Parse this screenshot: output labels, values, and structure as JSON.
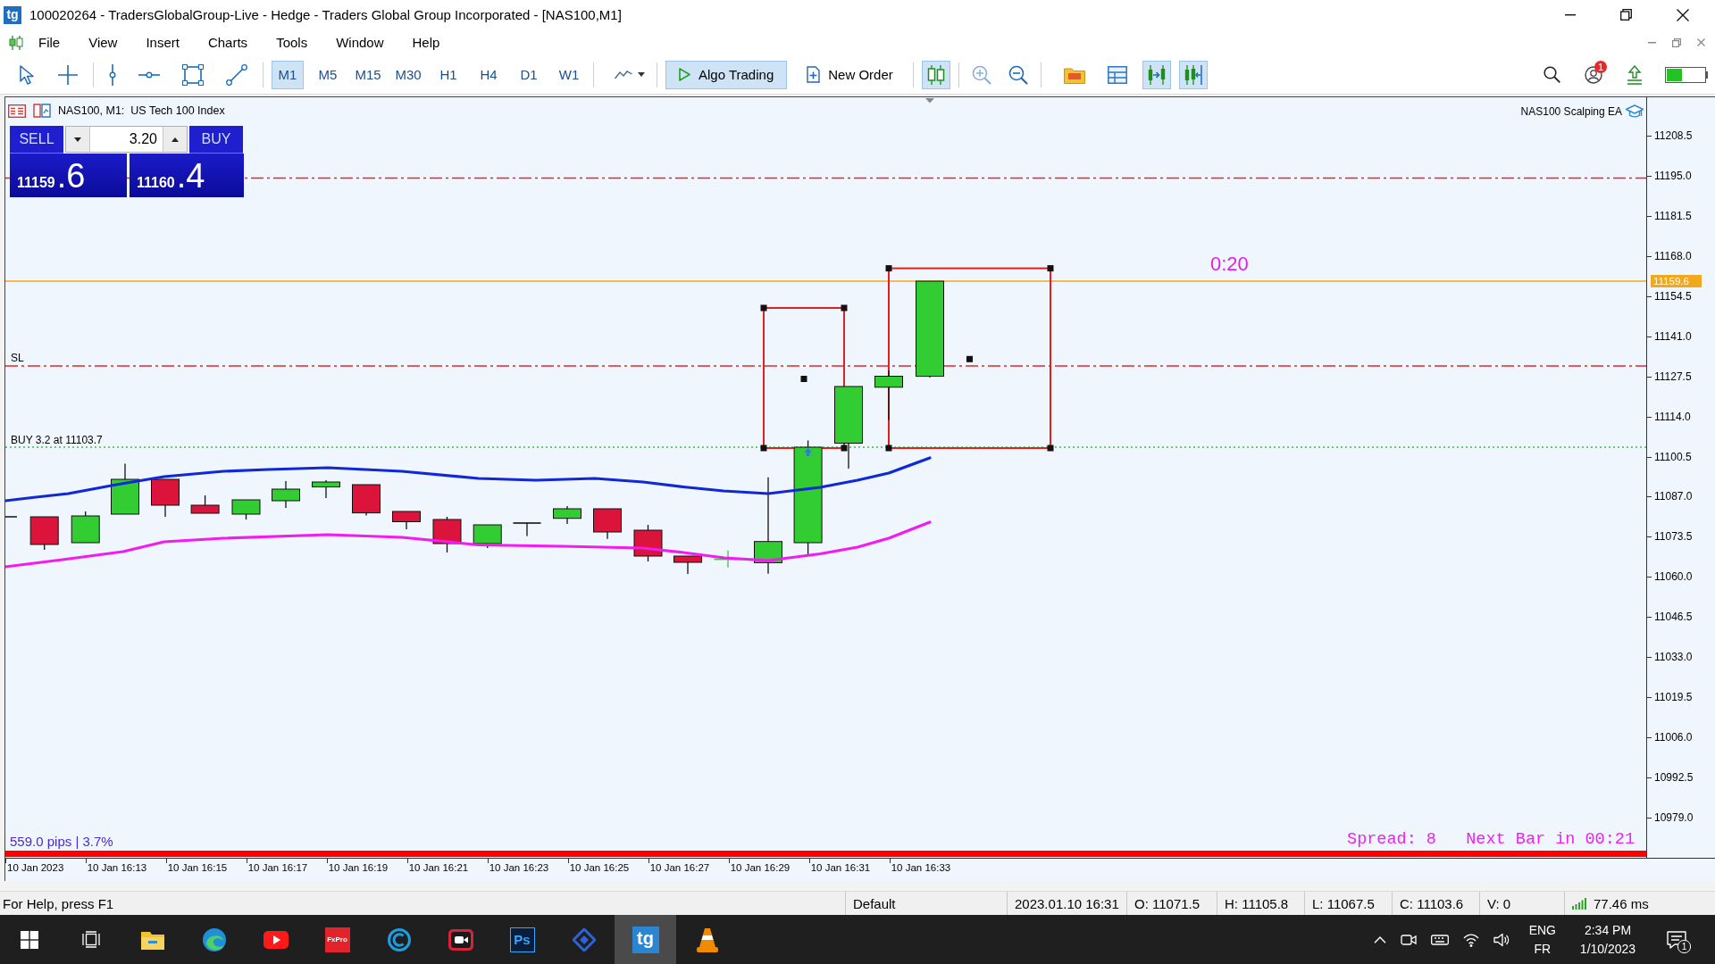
{
  "window": {
    "icon_text": "tg",
    "title": "100020264 - TradersGlobalGroup-Live - Hedge - Traders Global Group Incorporated - [NAS100,M1]"
  },
  "menu": [
    {
      "label": "File"
    },
    {
      "label": "View"
    },
    {
      "label": "Insert"
    },
    {
      "label": "Charts"
    },
    {
      "label": "Tools"
    },
    {
      "label": "Window"
    },
    {
      "label": "Help"
    }
  ],
  "toolbar": {
    "timeframes": [
      {
        "label": "M1",
        "selected": true
      },
      {
        "label": "M5",
        "selected": false
      },
      {
        "label": "M15",
        "selected": false
      },
      {
        "label": "M30",
        "selected": false
      },
      {
        "label": "H1",
        "selected": false
      },
      {
        "label": "H4",
        "selected": false
      },
      {
        "label": "D1",
        "selected": false
      },
      {
        "label": "W1",
        "selected": false
      }
    ],
    "algo_trading": {
      "label": "Algo Trading",
      "on": true
    },
    "new_order": {
      "label": "New Order"
    },
    "candlesticks_on": true,
    "autoscroll_on": true,
    "chart_shift_on": true,
    "notification_count": "1"
  },
  "chart": {
    "title": "NAS100, M1:  US Tech 100 Index",
    "expert": "NAS100 Scalping EA",
    "trade_panel": {
      "sell_label": "SELL",
      "buy_label": "BUY",
      "volume": "3.20",
      "bid_main": "11159",
      "bid_fraction": ".6",
      "ask_main": "11160",
      "ask_fraction": ".4"
    },
    "sl_label": "SL",
    "position_label": "BUY 3.2 at 11103.7",
    "bar_timer": "0:20",
    "footer_left": "559.0 pips | 3.7%",
    "footer_right": "Spread: 8   Next Bar in 00:21",
    "current_price": "11159.6",
    "price_axis": [
      "11208.5",
      "11195.0",
      "11181.5",
      "11168.0",
      "11154.5",
      "11141.0",
      "11127.5",
      "11114.0",
      "11100.5",
      "11087.0",
      "11073.5",
      "11060.0",
      "11046.5",
      "11033.0",
      "11019.5",
      "11006.0",
      "10992.5",
      "10979.0"
    ],
    "time_axis": [
      "10 Jan 2023",
      "10 Jan 16:13",
      "10 Jan 16:15",
      "10 Jan 16:17",
      "10 Jan 16:19",
      "10 Jan 16:21",
      "10 Jan 16:23",
      "10 Jan 16:25",
      "10 Jan 16:27",
      "10 Jan 16:29",
      "10 Jan 16:31",
      "10 Jan 16:33"
    ]
  },
  "status_bar": {
    "help": "For Help, press F1",
    "profile": "Default",
    "datetime": "2023.01.10 16:31",
    "open": "O: 11071.5",
    "high": "H: 11105.8",
    "low": "L: 11067.5",
    "close": "C: 11103.6",
    "volume": "V: 0",
    "ping": "77.46 ms"
  },
  "taskbar": {
    "apps": [
      {
        "kind": "folder",
        "selected": false
      },
      {
        "kind": "browser",
        "selected": false
      },
      {
        "kind": "video",
        "selected": false
      },
      {
        "kind": "fxpro",
        "text": "FxPro",
        "selected": false
      },
      {
        "kind": "ring",
        "selected": false
      },
      {
        "kind": "recorder",
        "selected": false
      },
      {
        "kind": "ps",
        "text": "Ps",
        "selected": false
      },
      {
        "kind": "diamond",
        "selected": false
      },
      {
        "kind": "tg",
        "text": "tg",
        "selected": true
      },
      {
        "kind": "cone",
        "selected": false
      }
    ],
    "language": "ENG",
    "layout": "FR",
    "time": "2:34 PM",
    "date": "1/10/2023",
    "notification_count": "1"
  }
}
